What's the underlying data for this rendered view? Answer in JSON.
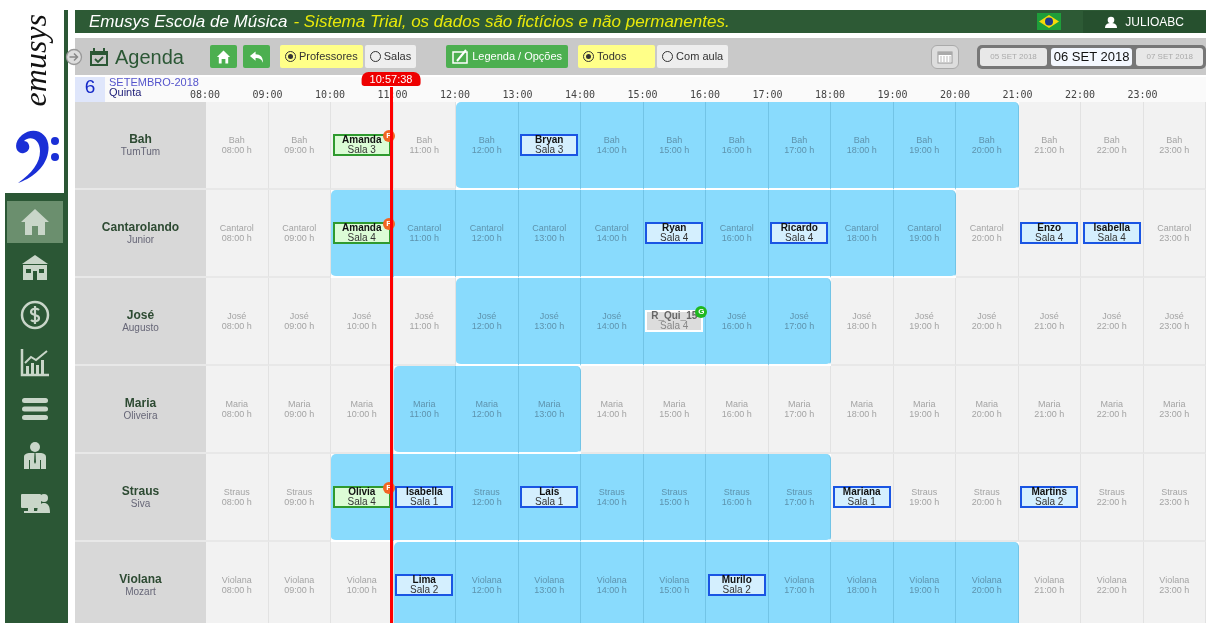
{
  "header": {
    "title": "Emusys Escola de Música",
    "subtitle": "- Sistema Trial, os dados são fictícios e não permanentes.",
    "user": "JULIOABC"
  },
  "sidebar": {
    "logo_text": "emusys",
    "items": [
      {
        "selected": true
      },
      {
        "selected": false
      },
      {
        "selected": false
      },
      {
        "selected": false
      },
      {
        "selected": false
      },
      {
        "selected": false
      },
      {
        "selected": false
      }
    ]
  },
  "toolbar": {
    "title": "Agenda",
    "view_options": [
      {
        "label": "Professores",
        "selected": true
      },
      {
        "label": "Salas",
        "selected": false
      }
    ],
    "legend_button": "Legenda / Opções",
    "filter_options": [
      {
        "label": "Todos",
        "selected": true
      },
      {
        "label": "Com aula",
        "selected": false
      }
    ],
    "dates": [
      {
        "label": "05 SET 2018",
        "selected": false
      },
      {
        "label": "06 SET 2018",
        "selected": true
      },
      {
        "label": "07 SET 2018",
        "selected": false
      }
    ]
  },
  "timeline": {
    "day": "6",
    "month": "SETEMBRO-2018",
    "weekday": "Quinta",
    "hours": [
      "08:00",
      "09:00",
      "10:00",
      "11:00",
      "12:00",
      "13:00",
      "14:00",
      "15:00",
      "16:00",
      "17:00",
      "18:00",
      "19:00",
      "20:00",
      "21:00",
      "22:00",
      "23:00"
    ],
    "now": "10:57:38"
  },
  "rows": [
    {
      "name": "Bah",
      "surname": "TumTum",
      "cells": [
        {
          "kind": "slot",
          "name": "Bah",
          "time": "08:00 h",
          "available": false
        },
        {
          "kind": "slot",
          "name": "Bah",
          "time": "09:00 h",
          "available": false
        },
        {
          "kind": "present",
          "student": "Amanda",
          "room": "Sala 3",
          "badge": {
            "letter": "F",
            "color": "#f26522"
          },
          "available": false
        },
        {
          "kind": "slot",
          "name": "Bah",
          "time": "11:00 h",
          "available": false
        },
        {
          "kind": "slot",
          "name": "Bah",
          "time": "12:00 h",
          "available": true
        },
        {
          "kind": "scheduled",
          "student": "Bryan",
          "room": "Sala 3",
          "available": true
        },
        {
          "kind": "slot",
          "name": "Bah",
          "time": "14:00 h",
          "available": true
        },
        {
          "kind": "slot",
          "name": "Bah",
          "time": "15:00 h",
          "available": true
        },
        {
          "kind": "slot",
          "name": "Bah",
          "time": "16:00 h",
          "available": true
        },
        {
          "kind": "slot",
          "name": "Bah",
          "time": "17:00 h",
          "available": true
        },
        {
          "kind": "slot",
          "name": "Bah",
          "time": "18:00 h",
          "available": true
        },
        {
          "kind": "slot",
          "name": "Bah",
          "time": "19:00 h",
          "available": true
        },
        {
          "kind": "slot",
          "name": "Bah",
          "time": "20:00 h",
          "available": true
        },
        {
          "kind": "slot",
          "name": "Bah",
          "time": "21:00 h",
          "available": false
        },
        {
          "kind": "slot",
          "name": "Bah",
          "time": "22:00 h",
          "available": false
        },
        {
          "kind": "slot",
          "name": "Bah",
          "time": "23:00 h",
          "available": false
        }
      ]
    },
    {
      "name": "Cantarolando",
      "surname": "Junior",
      "cells": [
        {
          "kind": "slot",
          "name": "Cantarol",
          "time": "08:00 h",
          "available": false
        },
        {
          "kind": "slot",
          "name": "Cantarol",
          "time": "09:00 h",
          "available": false
        },
        {
          "kind": "present",
          "student": "Amanda",
          "room": "Sala 4",
          "badge": {
            "letter": "F",
            "color": "#f26522"
          },
          "available": true
        },
        {
          "kind": "slot",
          "name": "Cantarol",
          "time": "11:00 h",
          "available": true
        },
        {
          "kind": "slot",
          "name": "Cantarol",
          "time": "12:00 h",
          "available": true
        },
        {
          "kind": "slot",
          "name": "Cantarol",
          "time": "13:00 h",
          "available": true
        },
        {
          "kind": "slot",
          "name": "Cantarol",
          "time": "14:00 h",
          "available": true
        },
        {
          "kind": "scheduled",
          "student": "Ryan",
          "room": "Sala 4",
          "available": true
        },
        {
          "kind": "slot",
          "name": "Cantarol",
          "time": "16:00 h",
          "available": true
        },
        {
          "kind": "scheduled",
          "student": "Ricardo",
          "room": "Sala 4",
          "available": true
        },
        {
          "kind": "slot",
          "name": "Cantarol",
          "time": "18:00 h",
          "available": true
        },
        {
          "kind": "slot",
          "name": "Cantarol",
          "time": "19:00 h",
          "available": true
        },
        {
          "kind": "slot",
          "name": "Cantarol",
          "time": "20:00 h",
          "available": false
        },
        {
          "kind": "scheduled",
          "student": "Enzo",
          "room": "Sala 4",
          "available": false
        },
        {
          "kind": "scheduled",
          "student": "Isabella",
          "room": "Sala 4",
          "available": false
        },
        {
          "kind": "slot",
          "name": "Cantarol",
          "time": "23:00 h",
          "available": false
        }
      ]
    },
    {
      "name": "José",
      "surname": "Augusto",
      "cells": [
        {
          "kind": "slot",
          "name": "José",
          "time": "08:00 h",
          "available": false
        },
        {
          "kind": "slot",
          "name": "José",
          "time": "09:00 h",
          "available": false
        },
        {
          "kind": "slot",
          "name": "José",
          "time": "10:00 h",
          "available": false
        },
        {
          "kind": "slot",
          "name": "José",
          "time": "11:00 h",
          "available": false
        },
        {
          "kind": "slot",
          "name": "José",
          "time": "12:00 h",
          "available": true
        },
        {
          "kind": "slot",
          "name": "José",
          "time": "13:00 h",
          "available": true
        },
        {
          "kind": "slot",
          "name": "José",
          "time": "14:00 h",
          "available": true
        },
        {
          "kind": "reserved",
          "student": "R_Qui_15",
          "room": "Sala 4",
          "badge": {
            "letter": "G",
            "color": "#1fb81f"
          },
          "available": true
        },
        {
          "kind": "slot",
          "name": "José",
          "time": "16:00 h",
          "available": true
        },
        {
          "kind": "slot",
          "name": "José",
          "time": "17:00 h",
          "available": true
        },
        {
          "kind": "slot",
          "name": "José",
          "time": "18:00 h",
          "available": false
        },
        {
          "kind": "slot",
          "name": "José",
          "time": "19:00 h",
          "available": false
        },
        {
          "kind": "slot",
          "name": "José",
          "time": "20:00 h",
          "available": false
        },
        {
          "kind": "slot",
          "name": "José",
          "time": "21:00 h",
          "available": false
        },
        {
          "kind": "slot",
          "name": "José",
          "time": "22:00 h",
          "available": false
        },
        {
          "kind": "slot",
          "name": "José",
          "time": "23:00 h",
          "available": false
        }
      ]
    },
    {
      "name": "Maria",
      "surname": "Oliveira",
      "cells": [
        {
          "kind": "slot",
          "name": "Maria",
          "time": "08:00 h",
          "available": false
        },
        {
          "kind": "slot",
          "name": "Maria",
          "time": "09:00 h",
          "available": false
        },
        {
          "kind": "slot",
          "name": "Maria",
          "time": "10:00 h",
          "available": false
        },
        {
          "kind": "slot",
          "name": "Maria",
          "time": "11:00 h",
          "available": true
        },
        {
          "kind": "slot",
          "name": "Maria",
          "time": "12:00 h",
          "available": true
        },
        {
          "kind": "slot",
          "name": "Maria",
          "time": "13:00 h",
          "available": true
        },
        {
          "kind": "slot",
          "name": "Maria",
          "time": "14:00 h",
          "available": false
        },
        {
          "kind": "slot",
          "name": "Maria",
          "time": "15:00 h",
          "available": false
        },
        {
          "kind": "slot",
          "name": "Maria",
          "time": "16:00 h",
          "available": false
        },
        {
          "kind": "slot",
          "name": "Maria",
          "time": "17:00 h",
          "available": false
        },
        {
          "kind": "slot",
          "name": "Maria",
          "time": "18:00 h",
          "available": false
        },
        {
          "kind": "slot",
          "name": "Maria",
          "time": "19:00 h",
          "available": false
        },
        {
          "kind": "slot",
          "name": "Maria",
          "time": "20:00 h",
          "available": false
        },
        {
          "kind": "slot",
          "name": "Maria",
          "time": "21:00 h",
          "available": false
        },
        {
          "kind": "slot",
          "name": "Maria",
          "time": "22:00 h",
          "available": false
        },
        {
          "kind": "slot",
          "name": "Maria",
          "time": "23:00 h",
          "available": false
        }
      ]
    },
    {
      "name": "Straus",
      "surname": "Siva",
      "cells": [
        {
          "kind": "slot",
          "name": "Straus",
          "time": "08:00 h",
          "available": false
        },
        {
          "kind": "slot",
          "name": "Straus",
          "time": "09:00 h",
          "available": false
        },
        {
          "kind": "present",
          "student": "Olivia",
          "room": "Sala 4",
          "badge": {
            "letter": "F",
            "color": "#f26522"
          },
          "available": true
        },
        {
          "kind": "scheduled",
          "student": "Isabella",
          "room": "Sala 1",
          "available": true
        },
        {
          "kind": "slot",
          "name": "Straus",
          "time": "12:00 h",
          "available": true
        },
        {
          "kind": "scheduled",
          "student": "Laís",
          "room": "Sala 1",
          "available": true
        },
        {
          "kind": "slot",
          "name": "Straus",
          "time": "14:00 h",
          "available": true
        },
        {
          "kind": "slot",
          "name": "Straus",
          "time": "15:00 h",
          "available": true
        },
        {
          "kind": "slot",
          "name": "Straus",
          "time": "16:00 h",
          "available": true
        },
        {
          "kind": "slot",
          "name": "Straus",
          "time": "17:00 h",
          "available": true
        },
        {
          "kind": "scheduled",
          "student": "Mariana",
          "room": "Sala 1",
          "available": false
        },
        {
          "kind": "slot",
          "name": "Straus",
          "time": "19:00 h",
          "available": false
        },
        {
          "kind": "slot",
          "name": "Straus",
          "time": "20:00 h",
          "available": false
        },
        {
          "kind": "scheduled",
          "student": "Martins",
          "room": "Sala 2",
          "available": false
        },
        {
          "kind": "slot",
          "name": "Straus",
          "time": "22:00 h",
          "available": false
        },
        {
          "kind": "slot",
          "name": "Straus",
          "time": "23:00 h",
          "available": false
        }
      ]
    },
    {
      "name": "Violana",
      "surname": "Mozart",
      "cells": [
        {
          "kind": "slot",
          "name": "Violana",
          "time": "08:00 h",
          "available": false
        },
        {
          "kind": "slot",
          "name": "Violana",
          "time": "09:00 h",
          "available": false
        },
        {
          "kind": "slot",
          "name": "Violana",
          "time": "10:00 h",
          "available": false
        },
        {
          "kind": "scheduled",
          "student": "Lima",
          "room": "Sala 2",
          "available": true
        },
        {
          "kind": "slot",
          "name": "Violana",
          "time": "12:00 h",
          "available": true
        },
        {
          "kind": "slot",
          "name": "Violana",
          "time": "13:00 h",
          "available": true
        },
        {
          "kind": "slot",
          "name": "Violana",
          "time": "14:00 h",
          "available": true
        },
        {
          "kind": "slot",
          "name": "Violana",
          "time": "15:00 h",
          "available": true
        },
        {
          "kind": "scheduled",
          "student": "Murilo",
          "room": "Sala 2",
          "available": true
        },
        {
          "kind": "slot",
          "name": "Violana",
          "time": "17:00 h",
          "available": true
        },
        {
          "kind": "slot",
          "name": "Violana",
          "time": "18:00 h",
          "available": true
        },
        {
          "kind": "slot",
          "name": "Violana",
          "time": "19:00 h",
          "available": true
        },
        {
          "kind": "slot",
          "name": "Violana",
          "time": "20:00 h",
          "available": true
        },
        {
          "kind": "slot",
          "name": "Violana",
          "time": "21:00 h",
          "available": false
        },
        {
          "kind": "slot",
          "name": "Violana",
          "time": "22:00 h",
          "available": false
        },
        {
          "kind": "slot",
          "name": "Violana",
          "time": "23:00 h",
          "available": false
        }
      ]
    }
  ]
}
